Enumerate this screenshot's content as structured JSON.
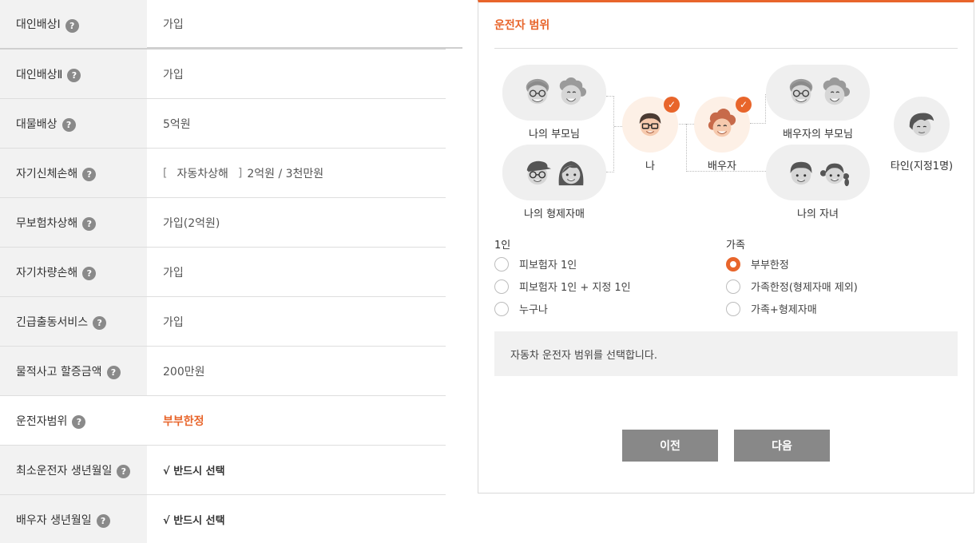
{
  "coverage": {
    "rows": [
      {
        "label": "대인배상Ⅰ",
        "value": "가입"
      },
      {
        "label": "대인배상Ⅱ",
        "value": "가입"
      },
      {
        "label": "대물배상",
        "value": "5억원"
      },
      {
        "label": "자기신체손해",
        "bracket_open": "[",
        "bracket_text": "자동차상해",
        "bracket_close": "]",
        "value": "2억원 / 3천만원"
      },
      {
        "label": "무보험차상해",
        "value": "가입(2억원)"
      },
      {
        "label": "자기차량손해",
        "value": "가입"
      },
      {
        "label": "긴급출동서비스",
        "value": "가입"
      },
      {
        "label": "물적사고 할증금액",
        "value": "200만원"
      },
      {
        "label": "운전자범위",
        "value": "부부한정"
      },
      {
        "label": "최소운전자 생년월일",
        "value": "√ 반드시 선택"
      },
      {
        "label": "배우자 생년월일",
        "value": "√ 반드시 선택"
      }
    ],
    "help_glyph": "?"
  },
  "panel": {
    "title": "운전자 범위",
    "people": {
      "my_parents": "나의 부모님",
      "my_siblings": "나의 형제자매",
      "me": "나",
      "spouse": "배우자",
      "spouse_parents": "배우자의 부모님",
      "my_children": "나의 자녀",
      "other": "타인(지정1명)"
    },
    "check_glyph": "✓",
    "groups": [
      {
        "title": "1인",
        "options": [
          {
            "label": "피보험자 1인",
            "checked": false
          },
          {
            "label": "피보험자 1인 + 지정 1인",
            "checked": false
          },
          {
            "label": "누구나",
            "checked": false
          }
        ]
      },
      {
        "title": "가족",
        "options": [
          {
            "label": "부부한정",
            "checked": true
          },
          {
            "label": "가족한정(형제자매 제외)",
            "checked": false
          },
          {
            "label": "가족+형제자매",
            "checked": false
          }
        ]
      }
    ],
    "info": "자동차 운전자 범위를 선택합니다.",
    "buttons": {
      "prev": "이전",
      "next": "다음"
    }
  },
  "colors": {
    "accent": "#e8652b",
    "button": "#888888"
  }
}
